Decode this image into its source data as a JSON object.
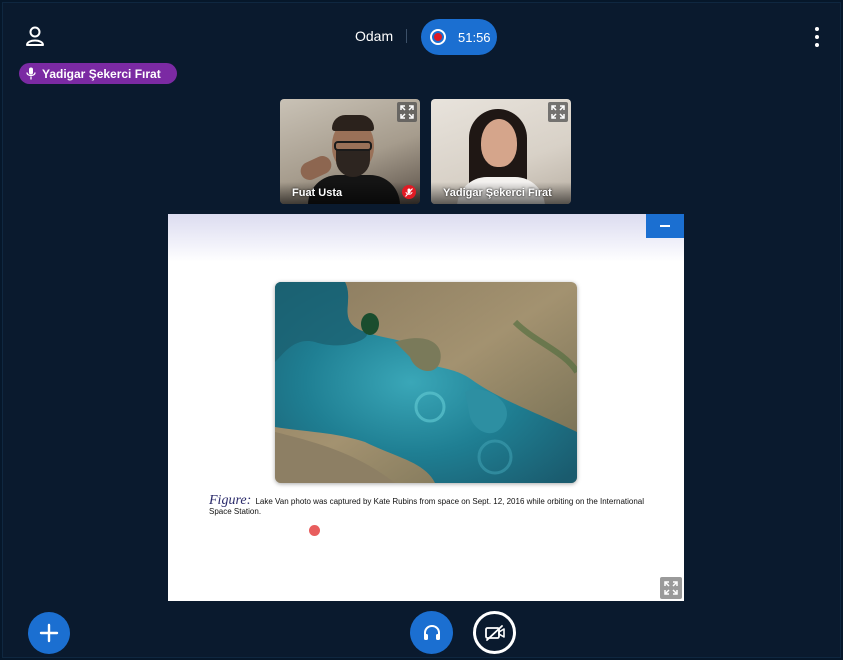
{
  "header": {
    "room_title": "Odam",
    "recording_time": "51:56"
  },
  "talker": {
    "name": "Yadigar Şekerci Fırat"
  },
  "participants": [
    {
      "name": "Fuat Usta",
      "muted": true
    },
    {
      "name": "Yadigar Şekerci Fırat",
      "muted": false
    }
  ],
  "presentation": {
    "caption_label": "Figure:",
    "caption_text": "Lake Van photo was captured by Kate Rubins from space on Sept. 12, 2016 while orbiting on the International Space Station."
  },
  "icons": {
    "user": "user-icon",
    "more": "more-vertical-icon",
    "record": "record-icon",
    "microphone": "microphone-icon",
    "expand": "expand-icon",
    "muted": "microphone-muted-icon",
    "minimize": "minimize-icon",
    "fullscreen": "fullscreen-icon",
    "plus": "plus-icon",
    "headphones": "headphones-icon",
    "video_off": "video-off-icon"
  },
  "colors": {
    "background": "#0a1a2e",
    "accent": "#1b6fd1",
    "talker_badge": "#7b2aa3",
    "record_dot": "#e01b24",
    "pointer": "#e85d5d"
  }
}
